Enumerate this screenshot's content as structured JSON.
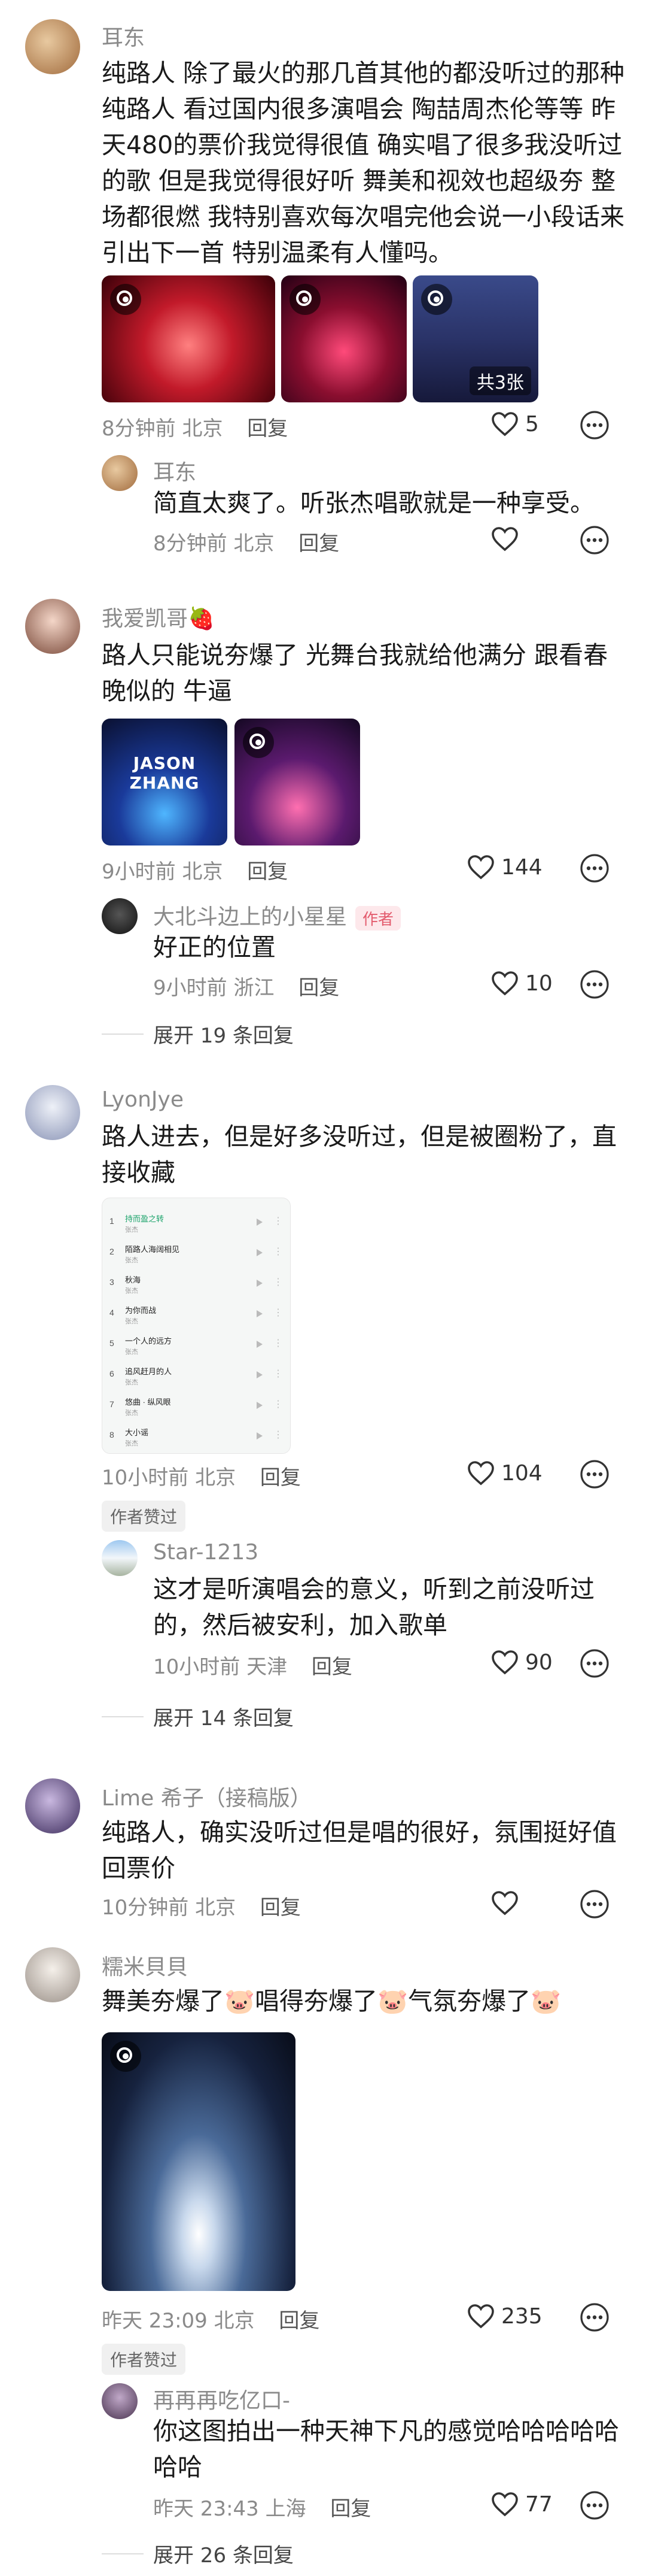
{
  "comments": [
    {
      "name": "耳东",
      "text": "纯路人 除了最火的那几首其他的都没听过的那种纯路人 看过国内很多演唱会 陶喆周杰伦等等 昨天480的票价我觉得很值 确实唱了很多我没听过的歌 但是我觉得很好听 舞美和视效也超级夯 整场都很燃 我特别喜欢每次唱完他会说一小段话来引出下一首 特别温柔有人懂吗。",
      "time": "8分钟前",
      "location": "北京",
      "reply_label": "回复",
      "likes": "5",
      "images_count_label": "共3张",
      "reply": {
        "name": "耳东",
        "text": "简直太爽了。听张杰唱歌就是一种享受。",
        "time": "8分钟前",
        "location": "北京",
        "reply_label": "回复"
      }
    },
    {
      "name": "我爱凯哥🍓",
      "text": "路人只能说夯爆了 光舞台我就给他满分 跟看春晚似的 牛逼",
      "time": "9小时前",
      "location": "北京",
      "reply_label": "回复",
      "likes": "144",
      "image_text": "JASON ZHANG",
      "reply": {
        "name": "大北斗边上的小星星",
        "author_tag": "作者",
        "text": "好正的位置",
        "time": "9小时前",
        "location": "浙江",
        "reply_label": "回复",
        "likes": "10"
      },
      "expand_label": "展开 19 条回复"
    },
    {
      "name": "LyonJye",
      "text": "路人进去，但是好多没听过，但是被圈粉了，直接收藏",
      "time": "10小时前",
      "location": "北京",
      "reply_label": "回复",
      "likes": "104",
      "tag": "作者赞过",
      "playlist": [
        {
          "n": "1",
          "title": "持而盈之转",
          "sub": "张杰"
        },
        {
          "n": "2",
          "title": "陌路人海阔相见",
          "sub": "张杰"
        },
        {
          "n": "3",
          "title": "秋海",
          "sub": "张杰"
        },
        {
          "n": "4",
          "title": "为你而战",
          "sub": "张杰"
        },
        {
          "n": "5",
          "title": "一个人的远方",
          "sub": "张杰"
        },
        {
          "n": "6",
          "title": "追风赶月的人",
          "sub": "张杰"
        },
        {
          "n": "7",
          "title": "悠曲 · 纵风眼",
          "sub": "张杰"
        },
        {
          "n": "8",
          "title": "大小谣",
          "sub": "张杰"
        }
      ],
      "reply": {
        "name": "Star-1213",
        "text": "这才是听演唱会的意义，听到之前没听过的，然后被安利，加入歌单",
        "time": "10小时前",
        "location": "天津",
        "reply_label": "回复",
        "likes": "90"
      },
      "expand_label": "展开 14 条回复"
    },
    {
      "name": "Lime 希子（接稿版）",
      "text": "纯路人，确实没听过但是唱的很好，氛围挺好值回票价",
      "time": "10分钟前",
      "location": "北京",
      "reply_label": "回复"
    },
    {
      "name": "糯米貝貝",
      "text": "舞美夯爆了🐷唱得夯爆了🐷气氛夯爆了🐷",
      "time": "昨天 23:09",
      "location": "北京",
      "reply_label": "回复",
      "likes": "235",
      "tag": "作者赞过",
      "reply": {
        "name": "再再再吃亿口-",
        "text": "你这图拍出一种天神下凡的感觉哈哈哈哈哈哈哈",
        "time": "昨天 23:43",
        "location": "上海",
        "reply_label": "回复",
        "likes": "77"
      },
      "expand_label": "展开 26 条回复"
    }
  ],
  "colors": {
    "meta": "#8a8a8a",
    "author_tag": "#e35b6d",
    "background": "#ffffff"
  }
}
